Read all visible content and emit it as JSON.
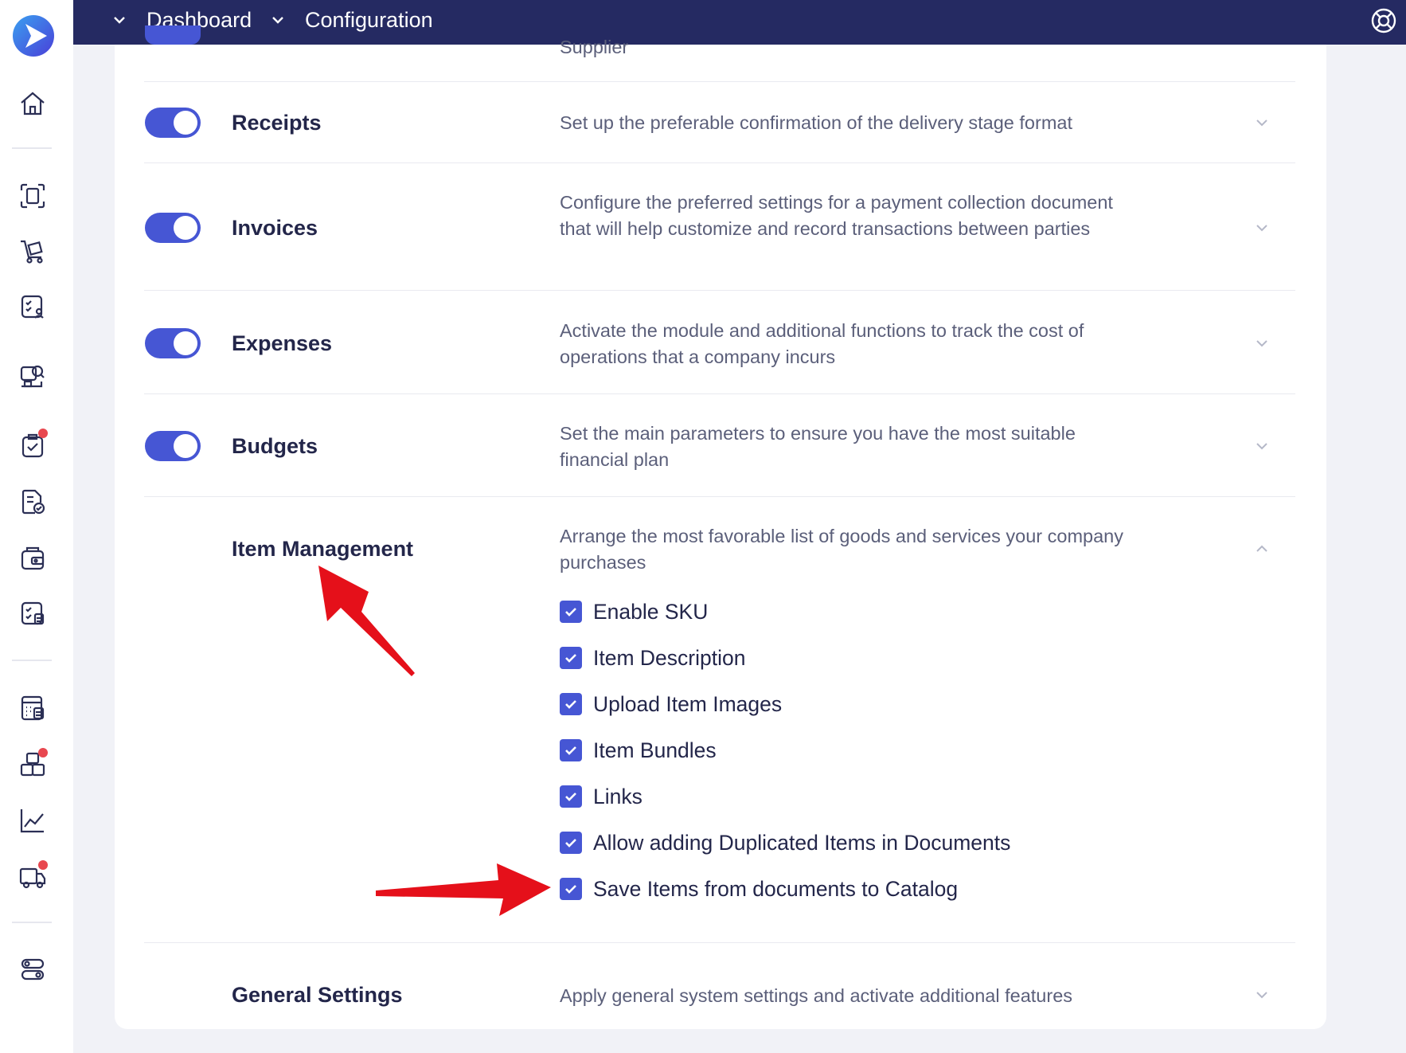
{
  "topbar": {
    "crumbs": [
      "Dashboard",
      "Configuration"
    ]
  },
  "sidebar": {
    "icons": [
      "home-icon",
      "scan-document-icon",
      "cart-icon",
      "task-list-icon",
      "search-supplier-icon",
      "clipboard-check-icon",
      "document-check-icon",
      "wallet-icon",
      "checklist-icon",
      "calculator-icon",
      "packages-icon",
      "chart-icon",
      "truck-icon",
      "toggle-settings-icon"
    ]
  },
  "partial_row": {
    "desc": "Supplier"
  },
  "rows": [
    {
      "title": "Receipts",
      "desc": "Set up the preferable confirmation of the delivery stage format",
      "enabled": true
    },
    {
      "title": "Invoices",
      "desc": "Configure the preferred settings for a payment collection document that will help customize and record transactions between parties",
      "enabled": true
    },
    {
      "title": "Expenses",
      "desc": "Activate the module and additional functions to track the cost of operations that a company incurs",
      "enabled": true
    },
    {
      "title": "Budgets",
      "desc": "Set the main parameters to ensure you have the most suitable financial plan",
      "enabled": true
    }
  ],
  "item_management": {
    "title": "Item Management",
    "desc": "Arrange the most favorable list of goods and services your company purchases",
    "options": [
      {
        "label": "Enable SKU",
        "checked": true
      },
      {
        "label": "Item Description",
        "checked": true
      },
      {
        "label": "Upload Item Images",
        "checked": true
      },
      {
        "label": "Item Bundles",
        "checked": true
      },
      {
        "label": "Links",
        "checked": true
      },
      {
        "label": "Allow adding Duplicated Items in Documents",
        "checked": true
      },
      {
        "label": "Save Items from documents to Catalog",
        "checked": true
      }
    ]
  },
  "general_settings": {
    "title": "General Settings",
    "desc": "Apply general system settings and activate additional features"
  },
  "colors": {
    "accent": "#4656d4",
    "topbar": "#252a62",
    "annotation_arrow": "#e5101a"
  }
}
